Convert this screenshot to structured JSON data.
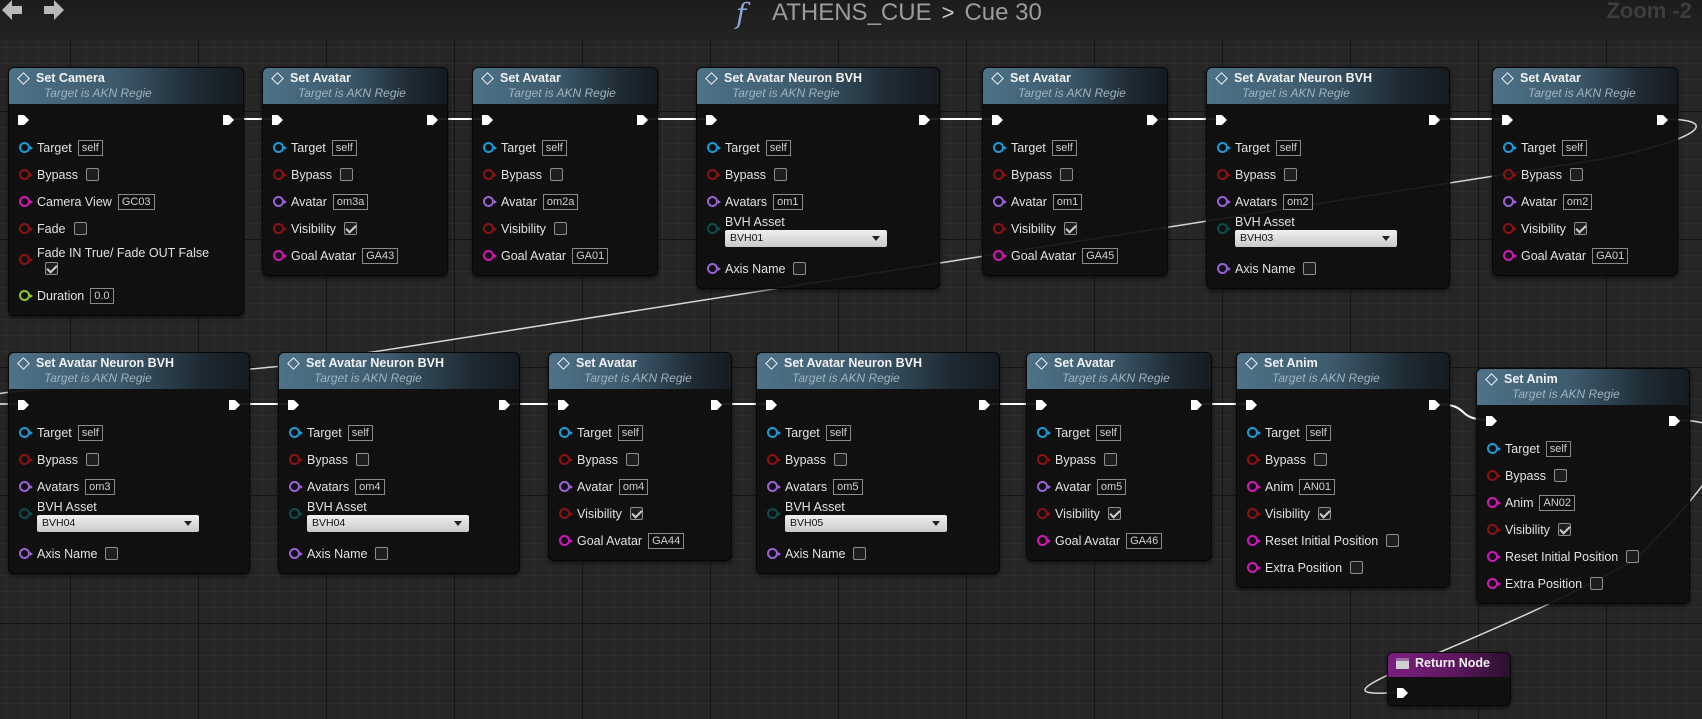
{
  "header": {
    "function_icon": "f",
    "graph_name": "ATHENS_CUE",
    "separator": ">",
    "cue_name": "Cue 30",
    "zoom": "Zoom -2"
  },
  "nodes": [
    {
      "title": "Set Camera",
      "subtitle": "Target is AKN Regie",
      "pins": [
        {
          "label": "Target",
          "value": "self"
        },
        {
          "label": "Bypass",
          "checked": false
        },
        {
          "label": "Camera View",
          "value": "GC03"
        },
        {
          "label": "Fade",
          "checked": false
        },
        {
          "label": "Fade IN True/ Fade OUT False",
          "checked": true
        },
        {
          "label": "Duration",
          "value": "0.0"
        }
      ]
    },
    {
      "title": "Set Avatar",
      "subtitle": "Target is AKN Regie",
      "pins": [
        {
          "label": "Target",
          "value": "self"
        },
        {
          "label": "Bypass",
          "checked": false
        },
        {
          "label": "Avatar",
          "value": "om3a"
        },
        {
          "label": "Visibility",
          "checked": true
        },
        {
          "label": "Goal Avatar",
          "value": "GA43"
        }
      ]
    },
    {
      "title": "Set Avatar",
      "subtitle": "Target is AKN Regie",
      "pins": [
        {
          "label": "Target",
          "value": "self"
        },
        {
          "label": "Bypass",
          "checked": false
        },
        {
          "label": "Avatar",
          "value": "om2a"
        },
        {
          "label": "Visibility",
          "checked": false
        },
        {
          "label": "Goal Avatar",
          "value": "GA01"
        }
      ]
    },
    {
      "title": "Set Avatar Neuron BVH",
      "subtitle": "Target is AKN Regie",
      "pins": [
        {
          "label": "Target",
          "value": "self"
        },
        {
          "label": "Bypass",
          "checked": false
        },
        {
          "label": "Avatars",
          "value": "om1"
        },
        {
          "label": "BVH Asset",
          "option": "BVH01"
        },
        {
          "label": "Axis Name",
          "checked": false
        }
      ]
    },
    {
      "title": "Set Avatar",
      "subtitle": "Target is AKN Regie",
      "pins": [
        {
          "label": "Target",
          "value": "self"
        },
        {
          "label": "Bypass",
          "checked": false
        },
        {
          "label": "Avatar",
          "value": "om1"
        },
        {
          "label": "Visibility",
          "checked": true
        },
        {
          "label": "Goal Avatar",
          "value": "GA45"
        }
      ]
    },
    {
      "title": "Set Avatar Neuron BVH",
      "subtitle": "Target is AKN Regie",
      "pins": [
        {
          "label": "Target",
          "value": "self"
        },
        {
          "label": "Bypass",
          "checked": false
        },
        {
          "label": "Avatars",
          "value": "om2"
        },
        {
          "label": "BVH Asset",
          "option": "BVH03"
        },
        {
          "label": "Axis Name",
          "checked": false
        }
      ]
    },
    {
      "title": "Set Avatar",
      "subtitle": "Target is AKN Regie",
      "pins": [
        {
          "label": "Target",
          "value": "self"
        },
        {
          "label": "Bypass",
          "checked": false
        },
        {
          "label": "Avatar",
          "value": "om2"
        },
        {
          "label": "Visibility",
          "checked": true
        },
        {
          "label": "Goal Avatar",
          "value": "GA01"
        }
      ]
    },
    {
      "title": "Set Avatar Neuron BVH",
      "subtitle": "Target is AKN Regie",
      "pins": [
        {
          "label": "Target",
          "value": "self"
        },
        {
          "label": "Bypass",
          "checked": false
        },
        {
          "label": "Avatars",
          "value": "om3"
        },
        {
          "label": "BVH Asset",
          "option": "BVH04"
        },
        {
          "label": "Axis Name",
          "checked": false
        }
      ]
    },
    {
      "title": "Set Avatar Neuron BVH",
      "subtitle": "Target is AKN Regie",
      "pins": [
        {
          "label": "Target",
          "value": "self"
        },
        {
          "label": "Bypass",
          "checked": false
        },
        {
          "label": "Avatars",
          "value": "om4"
        },
        {
          "label": "BVH Asset",
          "option": "BVH04"
        },
        {
          "label": "Axis Name",
          "checked": false
        }
      ]
    },
    {
      "title": "Set Avatar",
      "subtitle": "Target is AKN Regie",
      "pins": [
        {
          "label": "Target",
          "value": "self"
        },
        {
          "label": "Bypass",
          "checked": false
        },
        {
          "label": "Avatar",
          "value": "om4"
        },
        {
          "label": "Visibility",
          "checked": true
        },
        {
          "label": "Goal Avatar",
          "value": "GA44"
        }
      ]
    },
    {
      "title": "Set Avatar Neuron BVH",
      "subtitle": "Target is AKN Regie",
      "pins": [
        {
          "label": "Target",
          "value": "self"
        },
        {
          "label": "Bypass",
          "checked": false
        },
        {
          "label": "Avatars",
          "value": "om5"
        },
        {
          "label": "BVH Asset",
          "option": "BVH05"
        },
        {
          "label": "Axis Name",
          "checked": false
        }
      ]
    },
    {
      "title": "Set Avatar",
      "subtitle": "Target is AKN Regie",
      "pins": [
        {
          "label": "Target",
          "value": "self"
        },
        {
          "label": "Bypass",
          "checked": false
        },
        {
          "label": "Avatar",
          "value": "om5"
        },
        {
          "label": "Visibility",
          "checked": true
        },
        {
          "label": "Goal Avatar",
          "value": "GA46"
        }
      ]
    },
    {
      "title": "Set Anim",
      "subtitle": "Target is AKN Regie",
      "pins": [
        {
          "label": "Target",
          "value": "self"
        },
        {
          "label": "Bypass",
          "checked": false
        },
        {
          "label": "Anim",
          "value": "AN01"
        },
        {
          "label": "Visibility",
          "checked": true
        },
        {
          "label": "Reset Initial Position",
          "checked": false
        },
        {
          "label": "Extra Position",
          "checked": false
        }
      ]
    },
    {
      "title": "Set Anim",
      "subtitle": "Target is AKN Regie",
      "pins": [
        {
          "label": "Target",
          "value": "self"
        },
        {
          "label": "Bypass",
          "checked": false
        },
        {
          "label": "Anim",
          "value": "AN02"
        },
        {
          "label": "Visibility",
          "checked": true
        },
        {
          "label": "Reset Initial Position",
          "checked": false
        },
        {
          "label": "Extra Position",
          "checked": false
        }
      ]
    }
  ],
  "return_node": {
    "title": "Return Node"
  },
  "colors": {
    "exec": "#ffffff",
    "object_pin": "#1e9bd6",
    "bool_pin": "#8c1212",
    "string_pin": "#d31ab8",
    "name_pin": "#9a62d6",
    "float_pin": "#8ccc2c",
    "function_header": "#4e7288",
    "return_header": "#7b1e7f"
  }
}
